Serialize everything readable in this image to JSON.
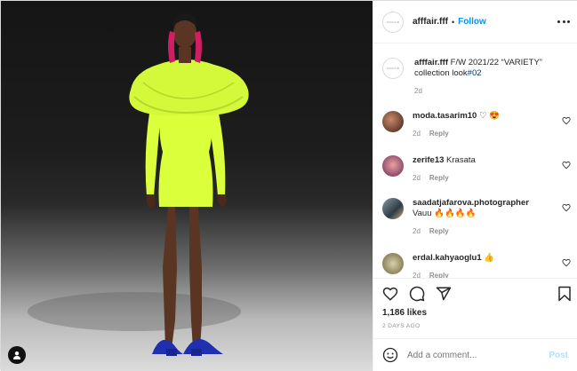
{
  "post": {
    "username": "afffair.fff",
    "separator": "•",
    "follow_label": "Follow",
    "brand_mark": "AFFFAIR"
  },
  "caption": {
    "username": "afffair.fff",
    "text": "F/W 2021/22 “VARIETY” collection look",
    "hashtag": "#02",
    "age": "2d"
  },
  "comments": [
    {
      "username": "moda.tasarim10",
      "text": "♡ 😍",
      "age": "2d",
      "reply": "Reply"
    },
    {
      "username": "zerife13",
      "text": "Krasata",
      "age": "2d",
      "reply": "Reply"
    },
    {
      "username": "saadatjafarova.photographer",
      "text": "Vauu 🔥🔥🔥🔥",
      "age": "2d",
      "reply": "Reply"
    },
    {
      "username": "erdal.kahyaoglu1",
      "text": "👍",
      "age": "2d",
      "reply": "Reply"
    }
  ],
  "actions": {
    "likes": "1,186 likes",
    "posted_ago": "2 DAYS AGO",
    "icons": [
      "heart-icon",
      "comment-icon",
      "share-icon",
      "bookmark-icon"
    ]
  },
  "add_comment": {
    "placeholder": "Add a comment...",
    "post_label": "Post"
  },
  "colors": {
    "accent": "#0095f6",
    "dress": "#dcff3c",
    "text": "#262626",
    "muted": "#8e8e8e"
  }
}
